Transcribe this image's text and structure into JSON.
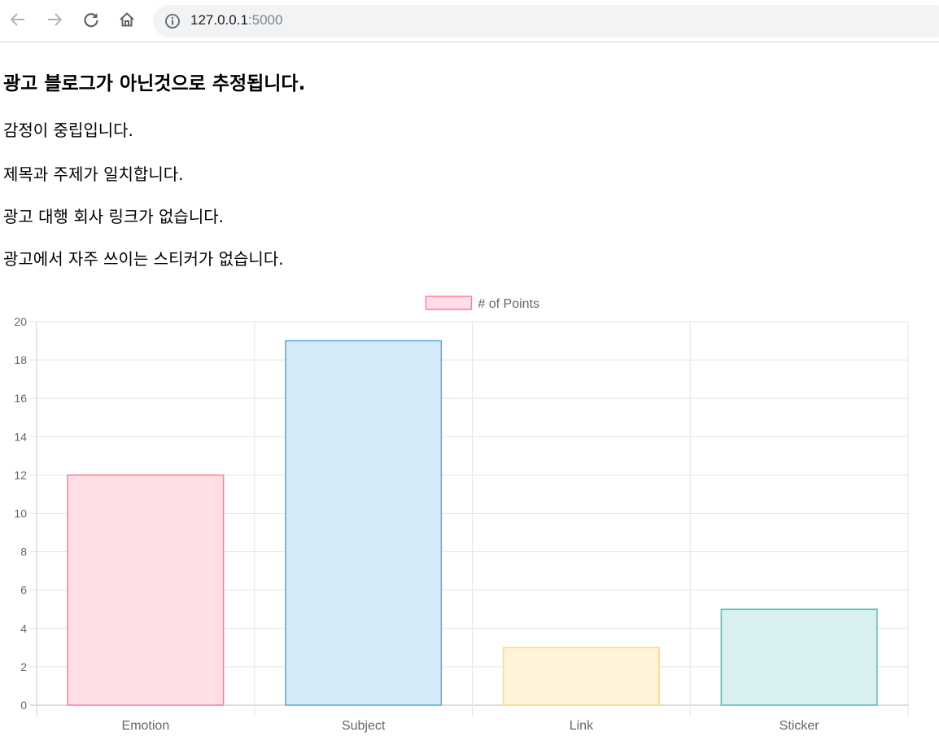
{
  "browser": {
    "url_host": "127.0.0.1",
    "url_port": ":5000"
  },
  "page": {
    "headline": "광고 블로그가 아닌것으로 추정됩니다.",
    "lines": [
      "감정이 중립입니다.",
      "제목과 주제가 일치합니다.",
      "광고 대행 회사 링크가 없습니다.",
      "광고에서 자주 쓰이는 스티커가 없습니다."
    ]
  },
  "chart_data": {
    "type": "bar",
    "categories": [
      "Emotion",
      "Subject",
      "Link",
      "Sticker"
    ],
    "series": [
      {
        "name": "# of Points",
        "values": [
          12,
          19,
          3,
          5
        ],
        "fill_colors": [
          "#ffdee5",
          "#d5eaf8",
          "#fff3da",
          "#d9f0f0"
        ],
        "border_colors": [
          "#ff829d",
          "#5eaee0",
          "#ffd97a",
          "#5cc0c0"
        ]
      }
    ],
    "legend_position": "top",
    "legend_swatch_fill": "#ffdee5",
    "legend_swatch_border": "#ff829d",
    "ylim": [
      0,
      20
    ],
    "yticks": [
      0,
      2,
      4,
      6,
      8,
      10,
      12,
      14,
      16,
      18,
      20
    ],
    "grid": true,
    "grid_color": "#e5e5e5",
    "tick_color": "#666666"
  }
}
